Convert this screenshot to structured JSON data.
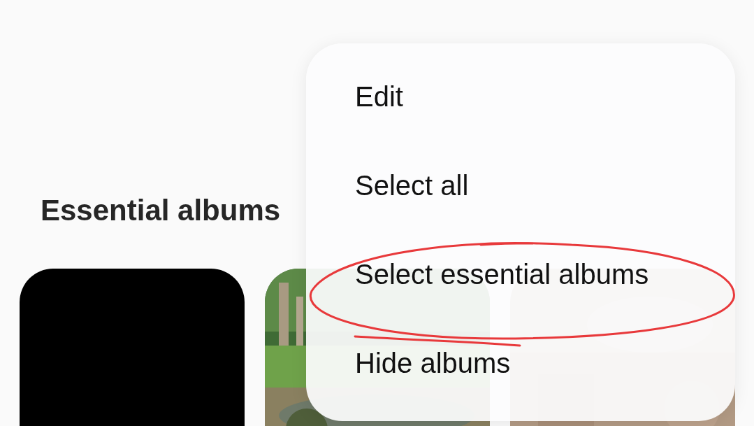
{
  "section": {
    "title": "Essential albums"
  },
  "albums": [
    {
      "kind": "blank"
    },
    {
      "kind": "picture"
    },
    {
      "kind": "picture"
    }
  ],
  "menu": {
    "items": [
      {
        "label": "Edit",
        "circled": false
      },
      {
        "label": "Select all",
        "circled": false
      },
      {
        "label": "Select essential albums",
        "circled": true
      },
      {
        "label": "Hide albums",
        "circled": false
      }
    ]
  }
}
